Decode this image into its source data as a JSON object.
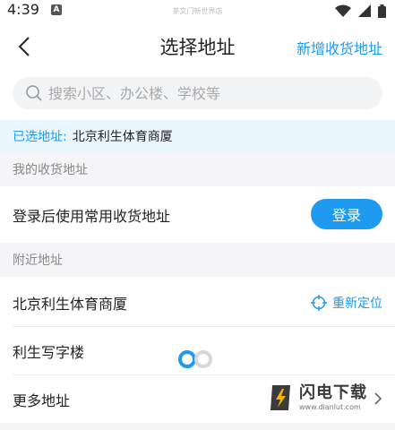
{
  "status_bar": {
    "time": "4:39",
    "app_badge": "A",
    "watermark": "茶文门新世界店",
    "icons": [
      "wifi-icon",
      "signal-icon",
      "battery-icon"
    ]
  },
  "header": {
    "back_icon": "chevron-left-icon",
    "title": "选择地址",
    "add_label": "新增收货地址"
  },
  "search": {
    "icon": "search-icon",
    "placeholder": "搜索小区、办公楼、学校等",
    "value": ""
  },
  "selected_address": {
    "label": "已选地址:",
    "value": "北京利生体育商厦"
  },
  "my_addresses": {
    "section_title": "我的收货地址",
    "login_hint": "登录后使用常用收货地址",
    "login_button": "登录"
  },
  "nearby": {
    "section_title": "附近地址",
    "relocate_label": "重新定位",
    "relocate_icon": "locate-icon",
    "items": [
      {
        "name": "北京利生体育商厦"
      },
      {
        "name": "利生写字楼"
      }
    ],
    "more_label": "更多地址",
    "more_icon": "chevron-right-icon"
  },
  "watermark_logo": {
    "name": "闪电下载",
    "url": "www.dianlut.com"
  },
  "colors": {
    "accent": "#1E9AF0",
    "selected_bg": "#EAF6FE",
    "section_bg": "#F5F5F7",
    "search_bg": "#F3F4F6"
  }
}
